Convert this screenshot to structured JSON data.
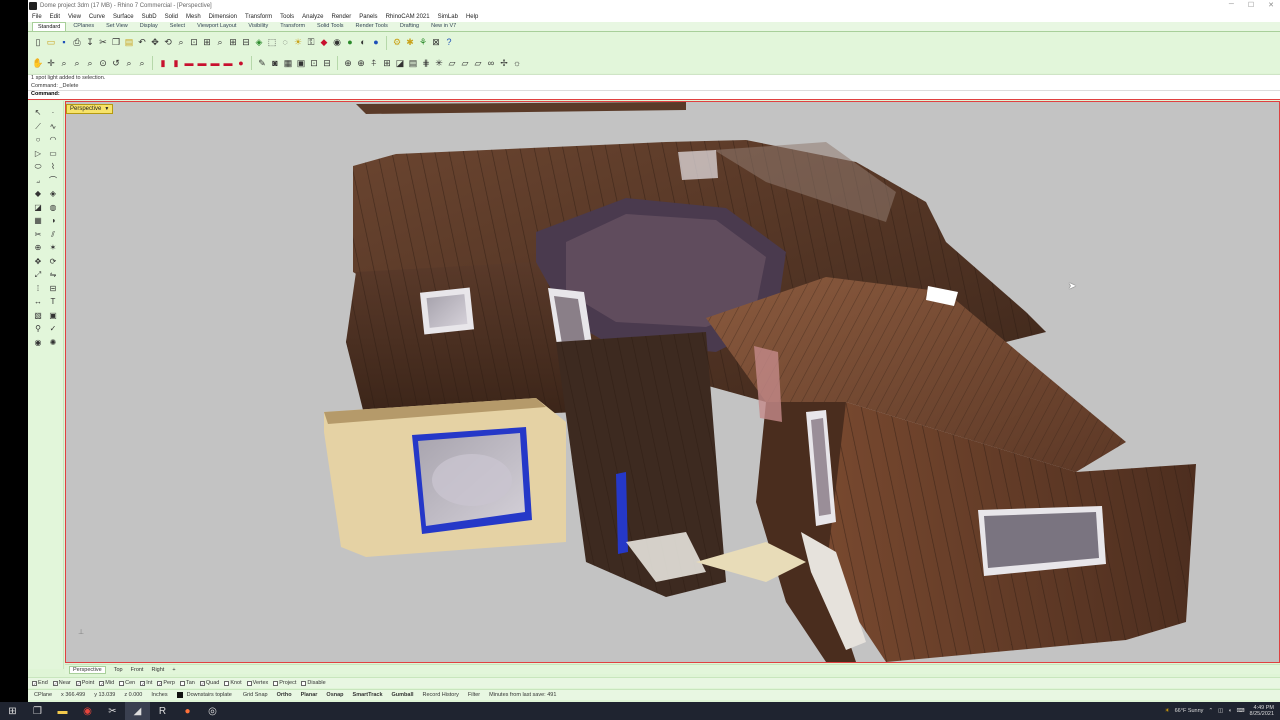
{
  "window": {
    "title": "Dome project 3dm (17 MB) - Rhino 7 Commercial - [Perspective]",
    "controls": [
      "─",
      "☐",
      "✕"
    ]
  },
  "menu": [
    "File",
    "Edit",
    "View",
    "Curve",
    "Surface",
    "SubD",
    "Solid",
    "Mesh",
    "Dimension",
    "Transform",
    "Tools",
    "Analyze",
    "Render",
    "Panels",
    "RhinoCAM 2021",
    "SimLab",
    "Help"
  ],
  "tabs": [
    "Standard",
    "CPlanes",
    "Set View",
    "Display",
    "Select",
    "Viewport Layout",
    "Visibility",
    "Transform",
    "Solid Tools",
    "Render Tools",
    "Drafting",
    "New in V7"
  ],
  "command": {
    "history1": "1 spot light added to selection.",
    "history2": "Command: _Delete",
    "prompt": "Command:"
  },
  "viewport": {
    "label": "Perspective",
    "background": "#c3c3c3"
  },
  "view_tabs": [
    "Perspective",
    "Top",
    "Front",
    "Right"
  ],
  "add_view": "+",
  "osnaps": [
    {
      "label": "End",
      "checked": true
    },
    {
      "label": "Near",
      "checked": true
    },
    {
      "label": "Point",
      "checked": true
    },
    {
      "label": "Mid",
      "checked": true
    },
    {
      "label": "Cen",
      "checked": false
    },
    {
      "label": "Int",
      "checked": true
    },
    {
      "label": "Perp",
      "checked": true
    },
    {
      "label": "Tan",
      "checked": false
    },
    {
      "label": "Quad",
      "checked": true
    },
    {
      "label": "Knot",
      "checked": false
    },
    {
      "label": "Vertex",
      "checked": false
    },
    {
      "label": "Project",
      "checked": false
    },
    {
      "label": "Disable",
      "checked": false
    }
  ],
  "status": {
    "cplane": "CPlane",
    "x": "x 366.499",
    "y": "y 13.039",
    "z": "z 0.000",
    "units": "Inches",
    "layer": "Downstairs toplate",
    "grid_snap": "Grid Snap",
    "ortho": "Ortho",
    "planar": "Planar",
    "osnap": "Osnap",
    "smarttrack": "SmartTrack",
    "gumball": "Gumball",
    "record_history": "Record History",
    "filter": "Filter",
    "save_msg": "Minutes from last save: 491"
  },
  "tray": {
    "weather": "66°F Sunny",
    "time": "4:49 PM",
    "date": "8/25/2021"
  },
  "colors": {
    "ui_green": "#dff5d6",
    "viewport_border": "#e04040",
    "label_yellow": "#f7e36a"
  }
}
